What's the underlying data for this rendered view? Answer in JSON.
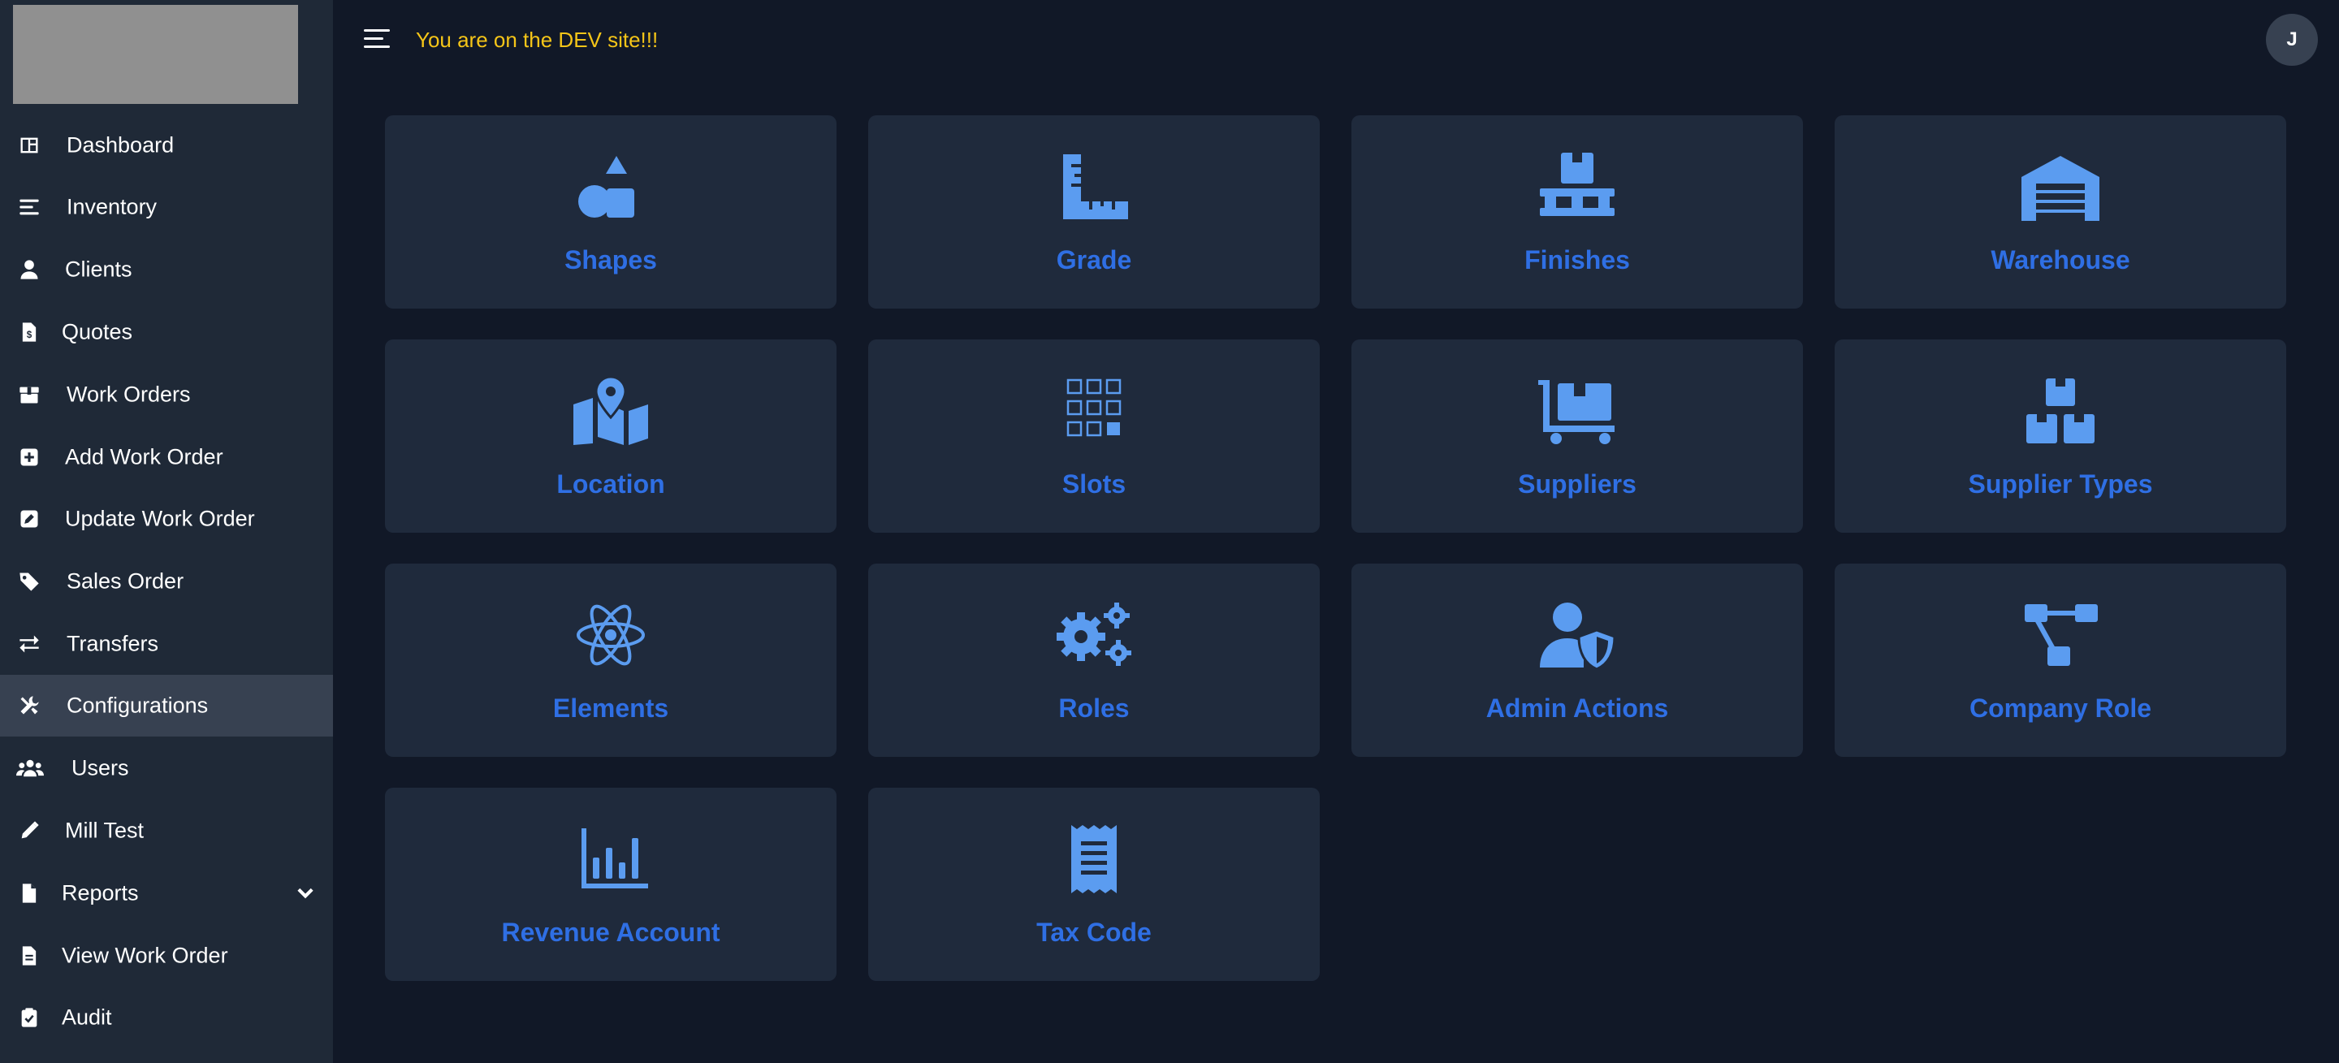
{
  "header": {
    "dev_banner": "You are on the DEV site!!!",
    "avatar_initial": "J"
  },
  "sidebar": {
    "items": [
      {
        "label": "Dashboard",
        "icon": "dashboard-icon"
      },
      {
        "label": "Inventory",
        "icon": "list-icon"
      },
      {
        "label": "Clients",
        "icon": "user-icon"
      },
      {
        "label": "Quotes",
        "icon": "invoice-icon"
      },
      {
        "label": "Work Orders",
        "icon": "box-icon"
      },
      {
        "label": "Add Work Order",
        "icon": "plus-square-icon"
      },
      {
        "label": "Update Work Order",
        "icon": "edit-square-icon"
      },
      {
        "label": "Sales Order",
        "icon": "tag-icon"
      },
      {
        "label": "Transfers",
        "icon": "transfer-arrows-icon"
      },
      {
        "label": "Configurations",
        "icon": "tools-icon",
        "active": true
      },
      {
        "label": "Users",
        "icon": "users-icon"
      },
      {
        "label": "Mill Test",
        "icon": "pen-icon"
      },
      {
        "label": "Reports",
        "icon": "file-icon",
        "has_submenu": true
      },
      {
        "label": "View Work Order",
        "icon": "file-lines-icon"
      },
      {
        "label": "Audit",
        "icon": "clipboard-check-icon"
      }
    ]
  },
  "cards": [
    {
      "label": "Shapes",
      "icon": "shapes-icon"
    },
    {
      "label": "Grade",
      "icon": "ruler-combined-icon"
    },
    {
      "label": "Finishes",
      "icon": "pallet-box-icon"
    },
    {
      "label": "Warehouse",
      "icon": "warehouse-icon"
    },
    {
      "label": "Location",
      "icon": "map-location-icon"
    },
    {
      "label": "Slots",
      "icon": "grid-slots-icon"
    },
    {
      "label": "Suppliers",
      "icon": "dolly-boxes-icon"
    },
    {
      "label": "Supplier Types",
      "icon": "stacked-boxes-icon"
    },
    {
      "label": "Elements",
      "icon": "atom-icon"
    },
    {
      "label": "Roles",
      "icon": "gears-icon"
    },
    {
      "label": "Admin Actions",
      "icon": "user-shield-icon"
    },
    {
      "label": "Company Role",
      "icon": "sitemap-icon"
    },
    {
      "label": "Revenue Account",
      "icon": "chart-column-icon"
    },
    {
      "label": "Tax Code",
      "icon": "receipt-icon"
    }
  ],
  "colors": {
    "background": "#111827",
    "sidebar": "#1f2937",
    "card": "#1f2a3c",
    "accent_text": "#2f6fe4",
    "icon": "#5b9cf0",
    "dev_banner": "#f5c518"
  }
}
